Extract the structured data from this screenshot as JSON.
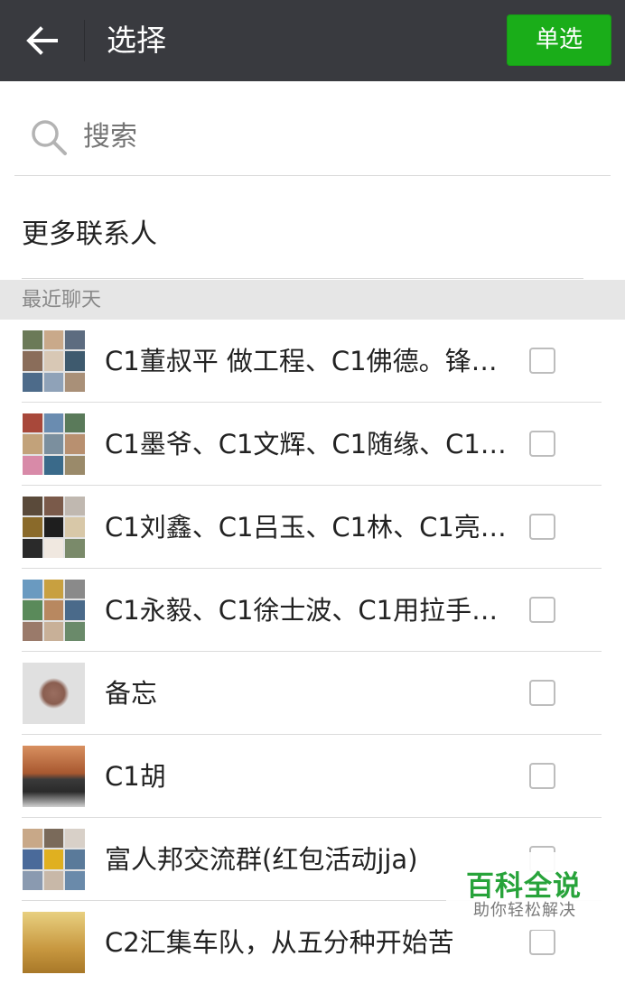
{
  "header": {
    "title": "选择",
    "single_label": "单选",
    "background": "#393a3f",
    "button_color": "#1aad19"
  },
  "search": {
    "placeholder": "搜索"
  },
  "more_contacts": "更多联系人",
  "section_title": "最近聊天",
  "chats": [
    {
      "name": "C1董叔平 做工程、C1佛德。锋…"
    },
    {
      "name": "C1墨爷、C1文辉、C1随缘、C1…"
    },
    {
      "name": "C1刘鑫、C1吕玉、C1林、C1亮…"
    },
    {
      "name": "C1永毅、C1徐士波、C1用拉手…"
    },
    {
      "name": "备忘"
    },
    {
      "name": "C1胡"
    },
    {
      "name": "富人邦交流群(红包活动jja)"
    },
    {
      "name": "C2汇集车队，从五分种开始苦"
    }
  ],
  "watermark": {
    "title": "百科全说",
    "subtitle": "助你轻松解决"
  }
}
